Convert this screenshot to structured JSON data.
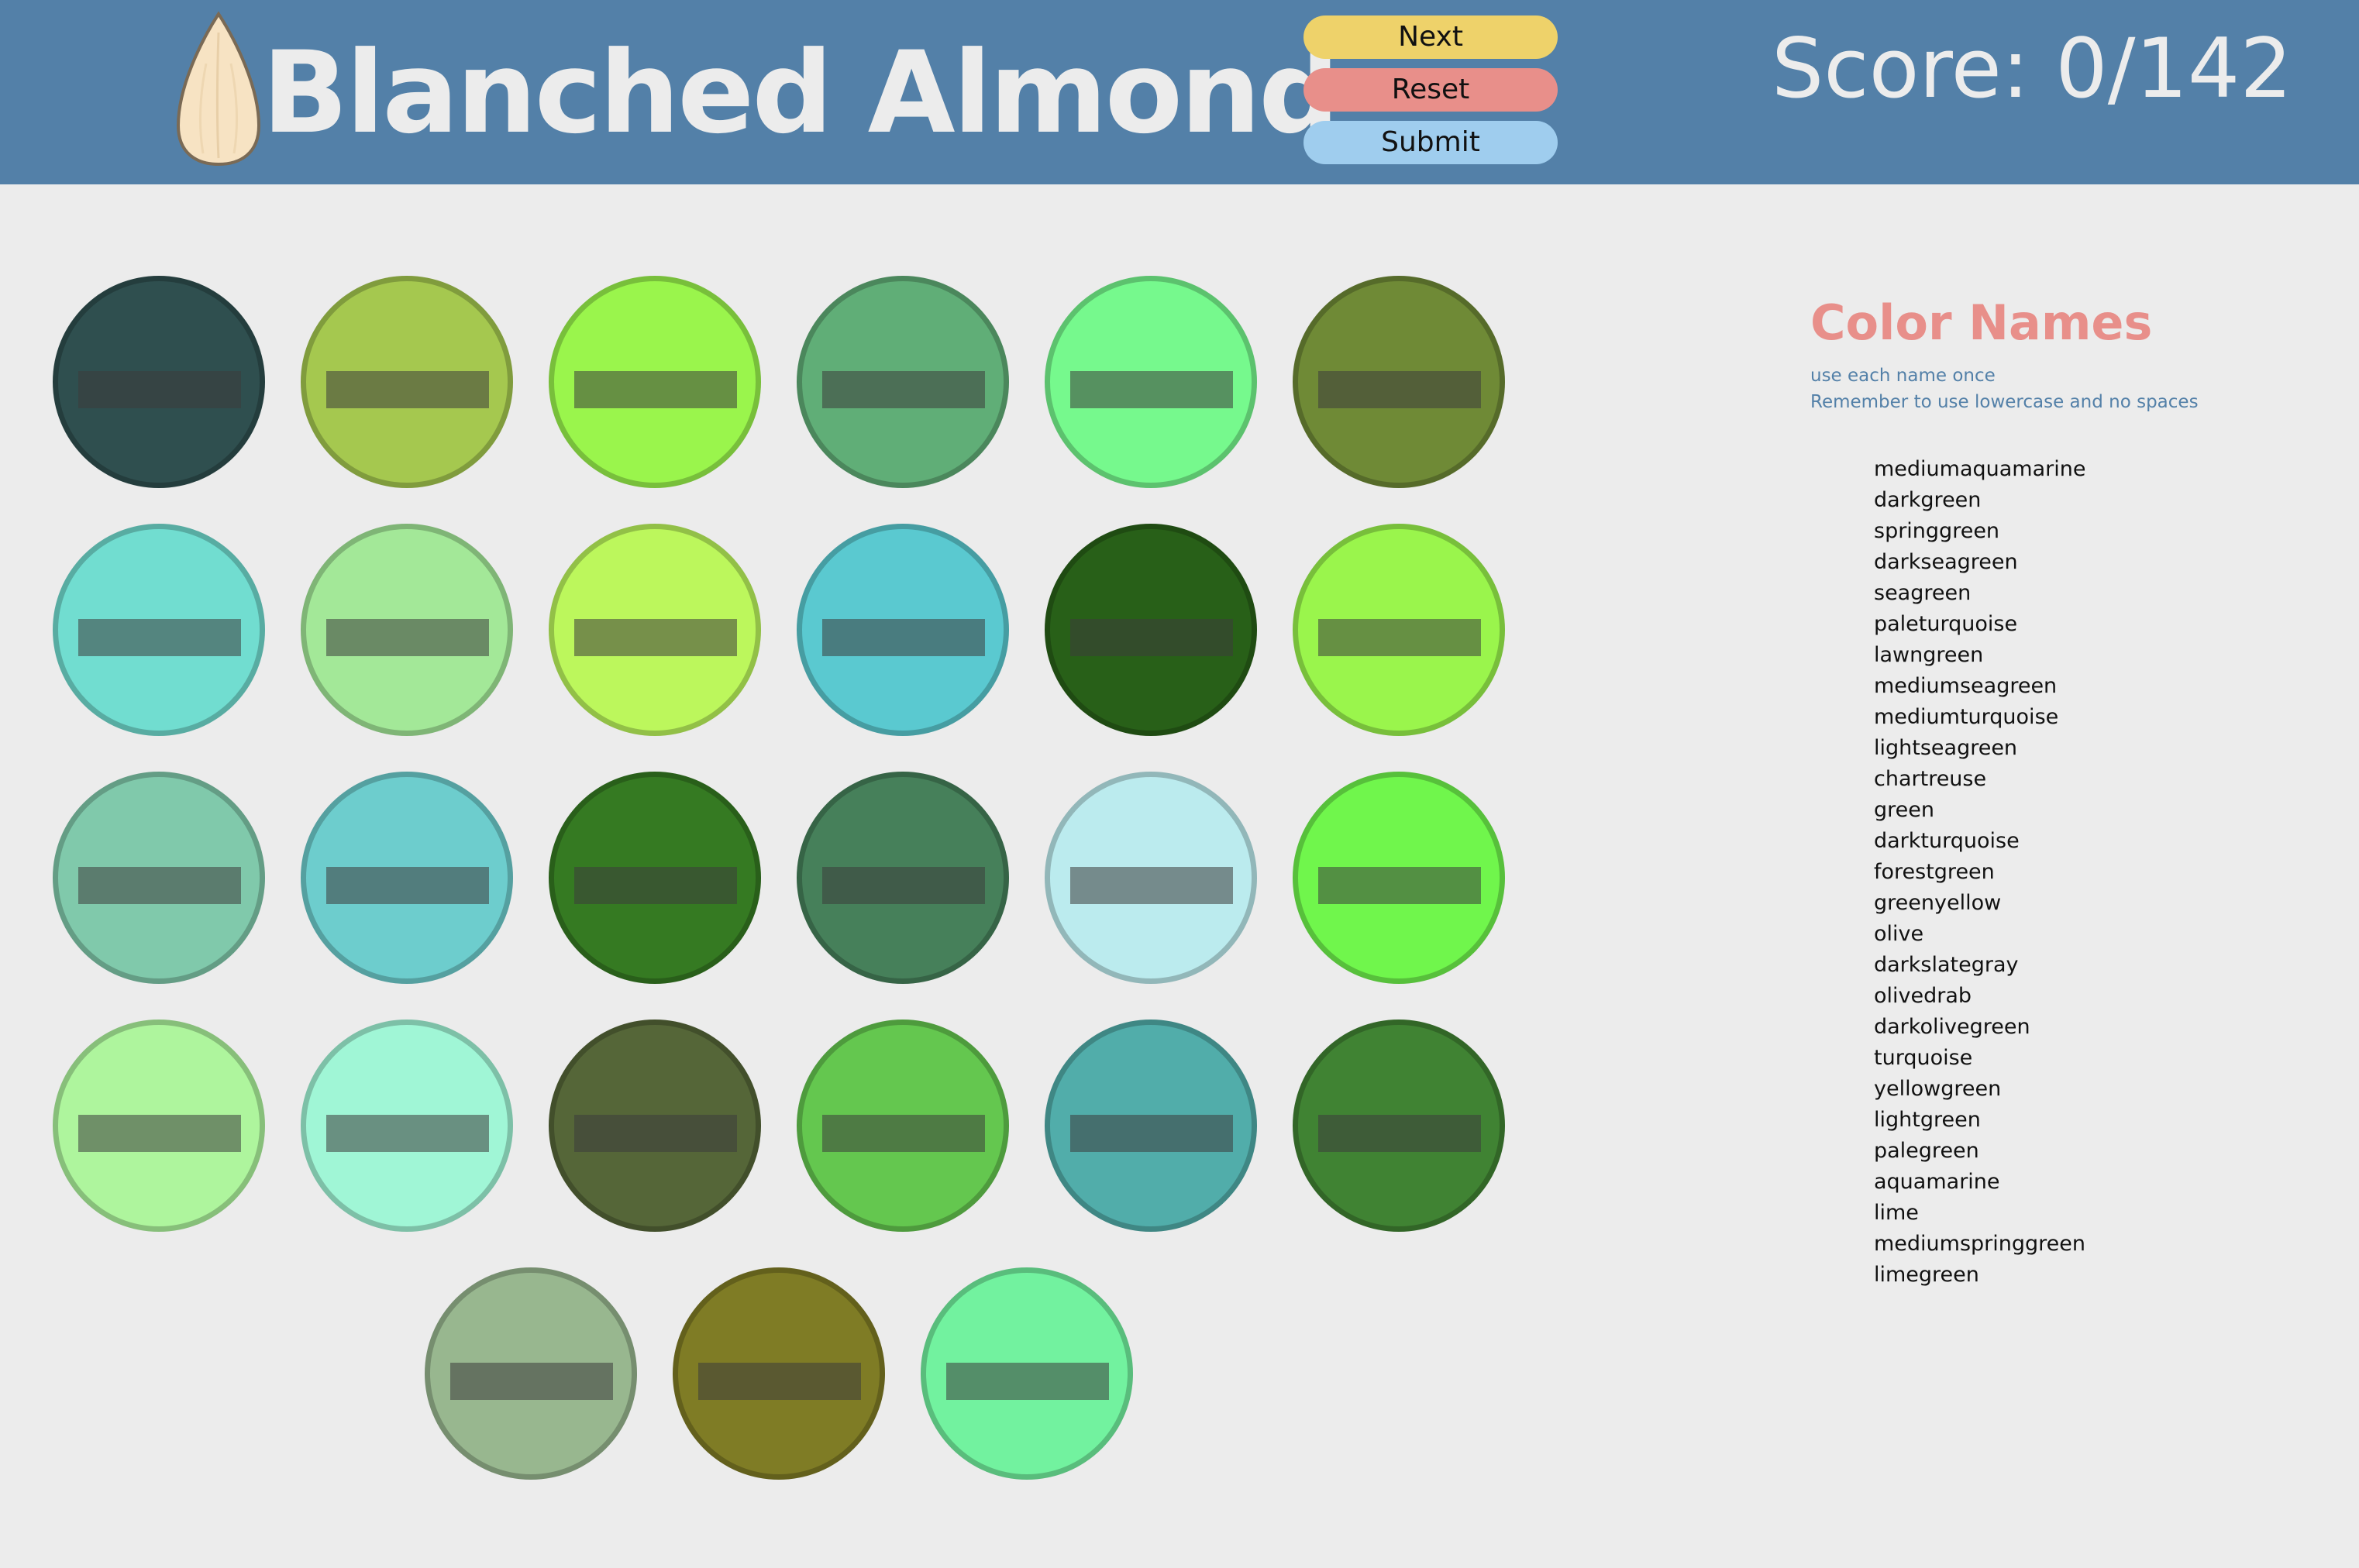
{
  "header": {
    "title": "Blanched Almond",
    "logo_icon": "almond-icon",
    "buttons": {
      "next": "Next",
      "reset": "Reset",
      "submit": "Submit"
    },
    "score": "Score: 0/142",
    "background": "#5380a8"
  },
  "swatches": [
    {
      "color": "#2f4f4f",
      "answer": ""
    },
    {
      "color": "#a5c84f",
      "answer": ""
    },
    {
      "color": "#9af54c",
      "answer": ""
    },
    {
      "color": "#60ae77",
      "answer": ""
    },
    {
      "color": "#76f98d",
      "answer": ""
    },
    {
      "color": "#6f8a36",
      "answer": ""
    },
    {
      "color": "#71ddd0",
      "answer": ""
    },
    {
      "color": "#a3e898",
      "answer": ""
    },
    {
      "color": "#bcf75c",
      "answer": ""
    },
    {
      "color": "#5ac9d0",
      "answer": ""
    },
    {
      "color": "#286018",
      "answer": ""
    },
    {
      "color": "#9af54c",
      "answer": ""
    },
    {
      "color": "#80c9ab",
      "answer": ""
    },
    {
      "color": "#6dcdcd",
      "answer": ""
    },
    {
      "color": "#357a22",
      "answer": ""
    },
    {
      "color": "#46805a",
      "answer": ""
    },
    {
      "color": "#bbebee",
      "answer": ""
    },
    {
      "color": "#70f64c",
      "answer": ""
    },
    {
      "color": "#aef59d",
      "answer": ""
    },
    {
      "color": "#a0f6d6",
      "answer": ""
    },
    {
      "color": "#556638",
      "answer": ""
    },
    {
      "color": "#64c74f",
      "answer": ""
    },
    {
      "color": "#51adaa",
      "answer": ""
    },
    {
      "color": "#408333",
      "answer": ""
    },
    {
      "color": "#98b78f",
      "answer": ""
    },
    {
      "color": "#7f7c25",
      "answer": ""
    },
    {
      "color": "#72f29f",
      "answer": ""
    }
  ],
  "sidebar": {
    "title": "Color Names",
    "hint1": "use each name once",
    "hint2": "Remember to use lowercase and no spaces",
    "title_color": "#e88f8a",
    "hint_color": "#5380a8",
    "names": [
      "mediumaquamarine",
      "darkgreen",
      "springgreen",
      "darkseagreen",
      "seagreen",
      "paleturquoise",
      "lawngreen",
      "mediumseagreen",
      "mediumturquoise",
      "lightseagreen",
      "chartreuse",
      "green",
      "darkturquoise",
      "forestgreen",
      "greenyellow",
      "olive",
      "darkslategray",
      "olivedrab",
      "darkolivegreen",
      "turquoise",
      "yellowgreen",
      "lightgreen",
      "palegreen",
      "aquamarine",
      "lime",
      "mediumspringgreen",
      "limegreen"
    ]
  }
}
